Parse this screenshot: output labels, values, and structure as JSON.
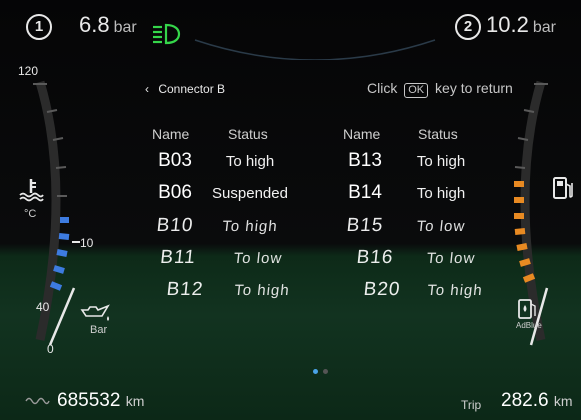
{
  "topbar": {
    "left": {
      "circuit": "1",
      "value": "6.8",
      "unit": "bar"
    },
    "right": {
      "circuit": "2",
      "value": "10.2",
      "unit": "bar"
    }
  },
  "gauges": {
    "temp": {
      "scale_top": "120",
      "scale_mid": "10",
      "scale_low": "40",
      "scale_bottom": "0",
      "unit": "°C",
      "accent": "#3d7be0",
      "oil_label": "Bar"
    },
    "fuel": {
      "accent": "#e88a22",
      "adblue_label": "AdBlue"
    }
  },
  "breadcrumb": {
    "label": "Connector B"
  },
  "hint": {
    "prefix": "Click",
    "key": "OK",
    "suffix": "key to return"
  },
  "table": {
    "headers": {
      "name": "Name",
      "status": "Status"
    },
    "left": [
      {
        "name": "B03",
        "status": "To high"
      },
      {
        "name": "B06",
        "status": "Suspended"
      },
      {
        "name": "B10",
        "status": "To high"
      },
      {
        "name": "B11",
        "status": "To low"
      },
      {
        "name": "B12",
        "status": "To high"
      }
    ],
    "right": [
      {
        "name": "B13",
        "status": "To high"
      },
      {
        "name": "B14",
        "status": "To high"
      },
      {
        "name": "B15",
        "status": "To low"
      },
      {
        "name": "B16",
        "status": "To low"
      },
      {
        "name": "B20",
        "status": "To high"
      }
    ]
  },
  "pager": {
    "active_color": "#4aa3e8",
    "inactive_color": "#555555"
  },
  "odometer": {
    "value": "685532",
    "unit": "km"
  },
  "trip": {
    "label": "Trip",
    "value": "282.6",
    "unit": "km"
  },
  "colors": {
    "headlight": "#35d64a"
  }
}
